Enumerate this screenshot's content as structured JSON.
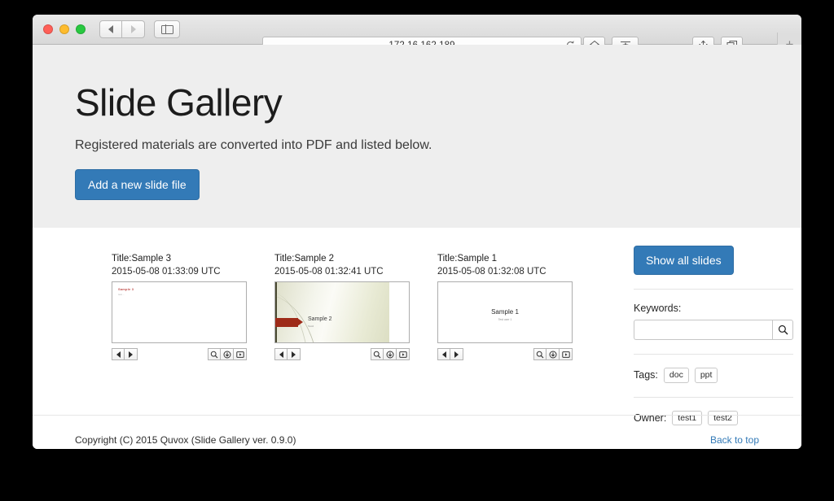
{
  "browser": {
    "url": "172.16.162.189",
    "back_label": "◀",
    "forward_label": "▶",
    "reload_label": "↻",
    "newtab_label": "+"
  },
  "hero": {
    "title": "Slide Gallery",
    "subtitle": "Registered materials are converted into PDF and listed below.",
    "add_button": "Add a new slide file",
    "accent_color": "#337ab7",
    "background_color": "#eeeeee"
  },
  "cards": [
    {
      "title": "Title:Sample 3",
      "date": "2015-05-08 01:33:09 UTC",
      "slide": {
        "heading": "Sample 3",
        "subheading": "test ...",
        "heading_color": "#c0504d"
      }
    },
    {
      "title": "Title:Sample 2",
      "date": "2015-05-08 01:32:41 UTC",
      "slide": {
        "heading": "Sample 2",
        "subheading": "Test2",
        "heading_color": "#3b3b3b"
      }
    },
    {
      "title": "Title:Sample 1",
      "date": "2015-05-08 01:32:08 UTC",
      "slide": {
        "heading": "Sample 1",
        "subheading": "Test user 1",
        "heading_color": "#2b2b2b"
      }
    }
  ],
  "sidebar": {
    "show_all_button": "Show all slides",
    "keywords_label": "Keywords:",
    "keywords_value": "",
    "keywords_placeholder": "",
    "tags_label": "Tags:",
    "tags": [
      "doc",
      "ppt"
    ],
    "owner_label": "Owner:",
    "owners": [
      "test1",
      "test2"
    ]
  },
  "footer": {
    "copyright": "Copyright (C) 2015 Quvox (Slide Gallery ver. 0.9.0)",
    "back_to_top": "Back to top"
  }
}
